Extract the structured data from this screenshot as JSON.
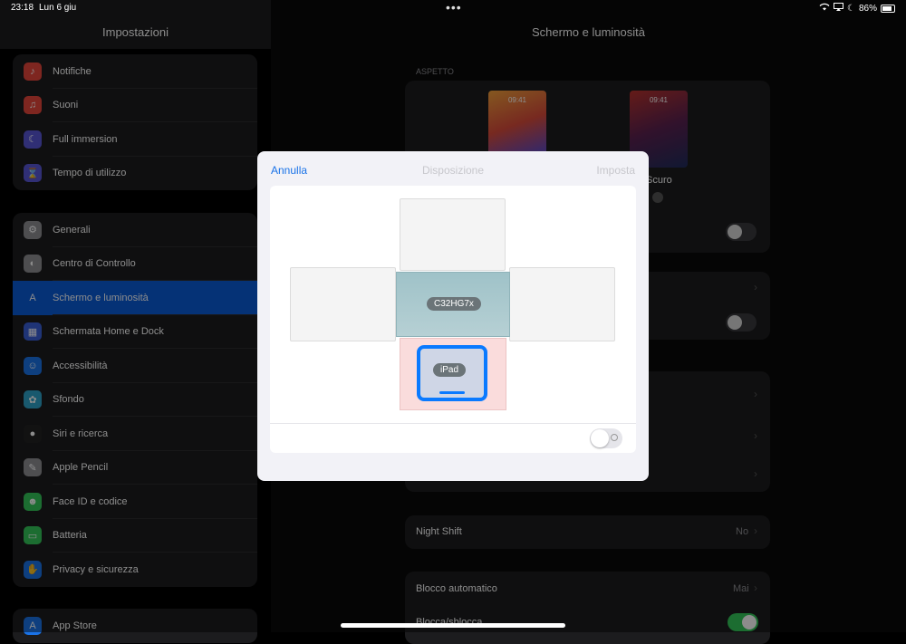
{
  "status": {
    "time": "23:18",
    "date": "Lun 6 giu",
    "battery": "86%"
  },
  "sidebar": {
    "title": "Impostazioni",
    "group1": [
      {
        "label": "Notifiche",
        "icon": "bell-icon",
        "color": "#e5453b"
      },
      {
        "label": "Suoni",
        "icon": "speaker-icon",
        "color": "#e5453b"
      },
      {
        "label": "Full immersion",
        "icon": "moon-icon",
        "color": "#5856d6"
      },
      {
        "label": "Tempo di utilizzo",
        "icon": "hourglass-icon",
        "color": "#5856d6"
      }
    ],
    "group2": [
      {
        "label": "Generali",
        "icon": "gear-icon",
        "color": "#8e8e93"
      },
      {
        "label": "Centro di Controllo",
        "icon": "toggles-icon",
        "color": "#8e8e93"
      },
      {
        "label": "Schermo e luminosità",
        "icon": "text-size-icon",
        "color": "#0a5bd8"
      },
      {
        "label": "Schermata Home e Dock",
        "icon": "grid-icon",
        "color": "#3a5fd8"
      },
      {
        "label": "Accessibilità",
        "icon": "accessibility-icon",
        "color": "#1a73e8"
      },
      {
        "label": "Sfondo",
        "icon": "flower-icon",
        "color": "#2ea3c8"
      },
      {
        "label": "Siri e ricerca",
        "icon": "siri-icon",
        "color": "#222222"
      },
      {
        "label": "Apple Pencil",
        "icon": "pencil-icon",
        "color": "#8e8e93"
      },
      {
        "label": "Face ID e codice",
        "icon": "faceid-icon",
        "color": "#34c759"
      },
      {
        "label": "Batteria",
        "icon": "battery-icon",
        "color": "#34c759"
      },
      {
        "label": "Privacy e sicurezza",
        "icon": "hand-icon",
        "color": "#1a73e8"
      }
    ],
    "group3": [
      {
        "label": "App Store",
        "icon": "appstore-icon",
        "color": "#1a73e8"
      }
    ]
  },
  "detail": {
    "title": "Schermo e luminosità",
    "section_appearance": "ASPETTO",
    "thumb_time": "09:41",
    "dark_label": "Scuro",
    "night_shift": {
      "label": "Night Shift",
      "value": "No"
    },
    "auto_lock": {
      "label": "Blocco automatico",
      "value": "Mai"
    },
    "lock_unlock": {
      "label": "Blocca/sblocca"
    }
  },
  "modal": {
    "cancel": "Annulla",
    "title": "Disposizione",
    "set": "Imposta",
    "external_display": "C32HG7x",
    "ipad_label": "iPad"
  },
  "colors": {
    "accent": "#0a7aff",
    "active_row": "#0a5bd8",
    "toggle_on": "#34c759"
  }
}
